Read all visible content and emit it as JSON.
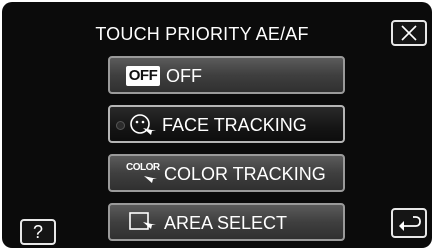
{
  "header": {
    "title": "TOUCH PRIORITY AE/AF",
    "close_icon": "close-icon"
  },
  "options": [
    {
      "label": "OFF",
      "icon": "off-icon",
      "icon_text": "OFF",
      "selected": false
    },
    {
      "label": "FACE TRACKING",
      "icon": "face-tracking-icon",
      "selected": true
    },
    {
      "label": "COLOR TRACKING",
      "icon": "color-tracking-icon",
      "icon_text": "COLOR",
      "selected": false
    },
    {
      "label": "AREA SELECT",
      "icon": "area-select-icon",
      "selected": false
    }
  ],
  "footer": {
    "help_label": "?",
    "back_icon": "return-icon"
  }
}
